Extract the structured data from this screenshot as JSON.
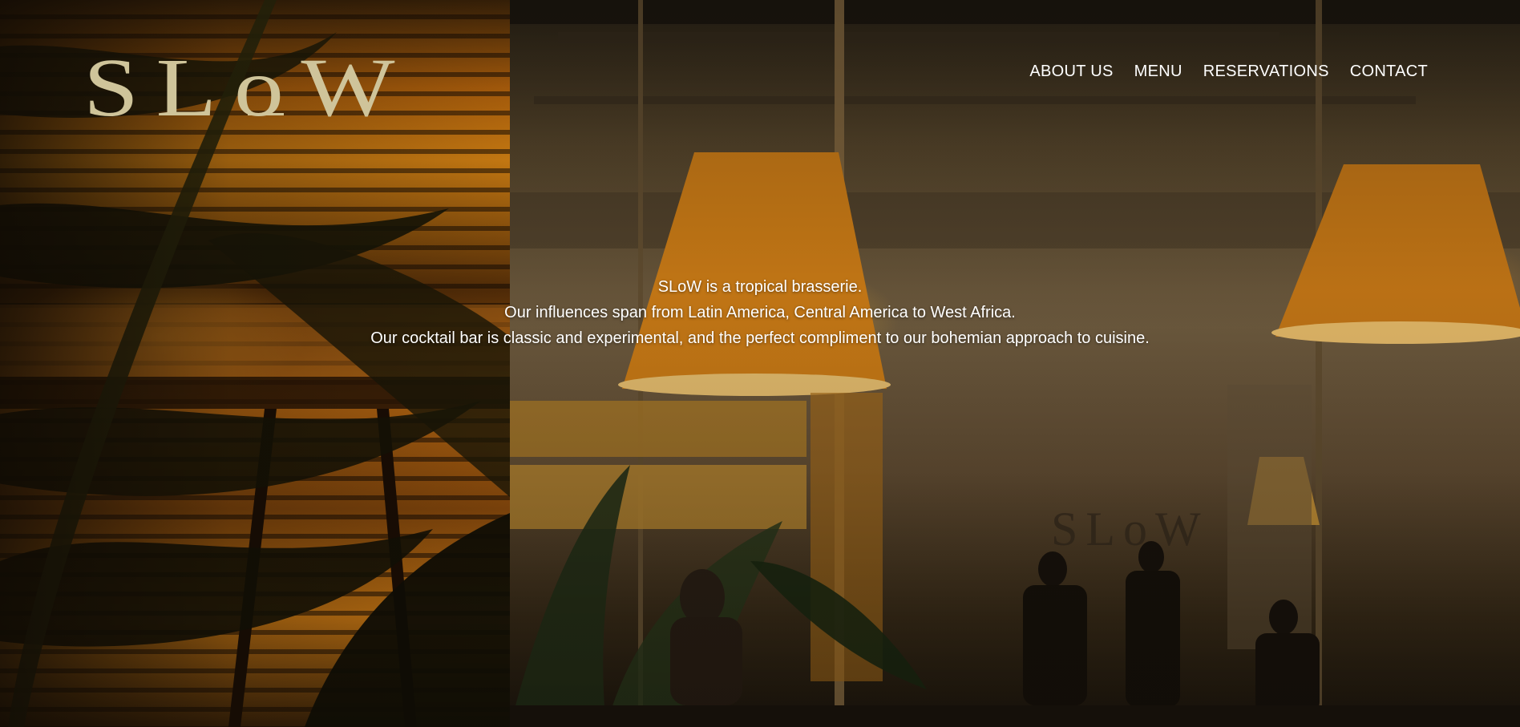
{
  "logo": {
    "text": "SLoW",
    "color": "#cfc49a"
  },
  "nav": {
    "items": [
      {
        "label": "ABOUT US"
      },
      {
        "label": "MENU"
      },
      {
        "label": "RESERVATIONS"
      },
      {
        "label": "CONTACT"
      }
    ]
  },
  "hero": {
    "line1": "SLoW is a tropical brasserie.",
    "line2": "Our influences span from Latin America, Central America to West Africa.",
    "line3": "Our cocktail bar is classic and experimental, and the perfect compliment to our bohemian approach to cuisine."
  },
  "colors": {
    "text": "#ffffff",
    "accent_gold": "#cfc49a",
    "lamp_glow": "#e8961c"
  }
}
